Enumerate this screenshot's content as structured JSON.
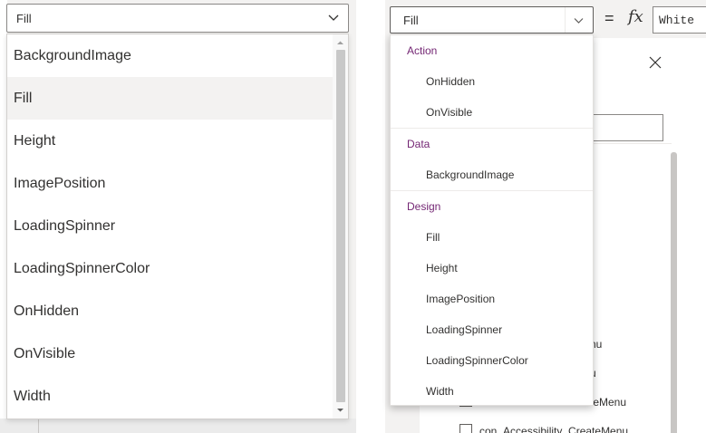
{
  "left_panel": {
    "select_value": "Fill",
    "items": [
      {
        "label": "BackgroundImage",
        "selected": false
      },
      {
        "label": "Fill",
        "selected": true
      },
      {
        "label": "Height",
        "selected": false
      },
      {
        "label": "ImagePosition",
        "selected": false
      },
      {
        "label": "LoadingSpinner",
        "selected": false
      },
      {
        "label": "LoadingSpinnerColor",
        "selected": false
      },
      {
        "label": "OnHidden",
        "selected": false
      },
      {
        "label": "OnVisible",
        "selected": false
      },
      {
        "label": "Width",
        "selected": false
      }
    ]
  },
  "right_panel": {
    "property_value": "Fill",
    "equals": "=",
    "fx": "fx",
    "formula_value": "White",
    "tree_fragments": [
      "nu",
      "u",
      "teMenu",
      "con_Accessibility_CreateMenu"
    ],
    "groups": [
      {
        "header": "Action",
        "items": [
          "OnHidden",
          "OnVisible"
        ]
      },
      {
        "header": "Data",
        "items": [
          "BackgroundImage"
        ]
      },
      {
        "header": "Design",
        "items": [
          "Fill",
          "Height",
          "ImagePosition",
          "LoadingSpinner",
          "LoadingSpinnerColor",
          "Width"
        ]
      }
    ]
  },
  "colors": {
    "group_header": "#742774",
    "selected_row": "#f3f2f1",
    "text": "#323130"
  },
  "icons": {
    "dropdown": "chevron-down-icon",
    "close": "close-icon",
    "scroll_up": "scroll-up-arrow-icon",
    "scroll_down": "scroll-down-arrow-icon"
  }
}
